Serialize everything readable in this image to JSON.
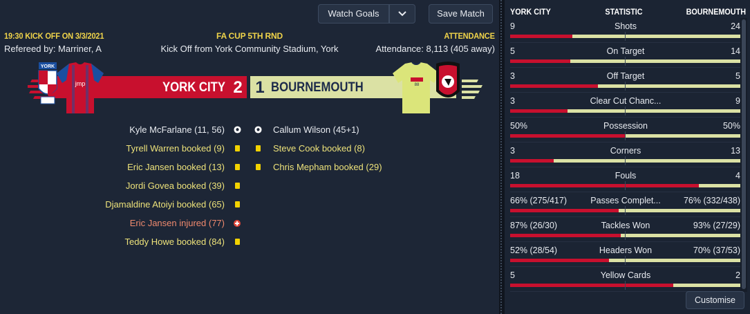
{
  "toolbar": {
    "watch_goals_label": "Watch Goals",
    "save_match_label": "Save Match"
  },
  "match": {
    "kickoff": "19:30 KICK OFF ON 3/3/2021",
    "competition": "FA CUP 5TH RND",
    "attendance_header": "ATTENDANCE",
    "referee": "Refereed by: Marriner, A",
    "venue": "Kick Off from York Community Stadium, York",
    "attendance": "Attendance: 8,113 (405 away)"
  },
  "score": {
    "home_team": "YORK CITY",
    "home_goals": "2",
    "away_goals": "1",
    "away_team": "BOURNEMOUTH"
  },
  "colors": {
    "home": "#c8102e",
    "away": "#dbe1a4",
    "card": "#f2d200"
  },
  "events": {
    "home": [
      {
        "text": "Kyle McFarlane (11, 56)",
        "type": "goal"
      },
      {
        "text": "Tyrell Warren booked (9)",
        "type": "yellow-card"
      },
      {
        "text": "Eric Jansen booked (13)",
        "type": "yellow-card"
      },
      {
        "text": "Jordi Govea booked (39)",
        "type": "yellow-card"
      },
      {
        "text": "Djamaldine Atoiyi booked (65)",
        "type": "yellow-card"
      },
      {
        "text": "Eric Jansen injured (77)",
        "type": "injury"
      },
      {
        "text": "Teddy Howe booked (84)",
        "type": "yellow-card"
      }
    ],
    "away": [
      {
        "text": "Callum Wilson (45+1)",
        "type": "goal"
      },
      {
        "text": "Steve Cook booked (8)",
        "type": "yellow-card"
      },
      {
        "text": "Chris Mepham booked (29)",
        "type": "yellow-card"
      }
    ]
  },
  "stats": {
    "header_home": "YORK CITY",
    "header_stat": "STATISTIC",
    "header_away": "BOURNEMOUTH",
    "rows": [
      {
        "home": "9",
        "label": "Shots",
        "away": "24",
        "home_share": 0.27
      },
      {
        "home": "5",
        "label": "On Target",
        "away": "14",
        "home_share": 0.26
      },
      {
        "home": "3",
        "label": "Off Target",
        "away": "5",
        "home_share": 0.38
      },
      {
        "home": "3",
        "label": "Clear Cut Chanc...",
        "away": "9",
        "home_share": 0.25
      },
      {
        "home": "50%",
        "label": "Possession",
        "away": "50%",
        "home_share": 0.5
      },
      {
        "home": "3",
        "label": "Corners",
        "away": "13",
        "home_share": 0.19
      },
      {
        "home": "18",
        "label": "Fouls",
        "away": "4",
        "home_share": 0.82
      },
      {
        "home": "66% (275/417)",
        "label": "Passes Complet...",
        "away": "76% (332/438)",
        "home_share": 0.47
      },
      {
        "home": "87% (26/30)",
        "label": "Tackles Won",
        "away": "93% (27/29)",
        "home_share": 0.48
      },
      {
        "home": "52% (28/54)",
        "label": "Headers Won",
        "away": "70% (37/53)",
        "home_share": 0.43
      },
      {
        "home": "5",
        "label": "Yellow Cards",
        "away": "2",
        "home_share": 0.71
      }
    ],
    "customise_label": "Customise"
  }
}
